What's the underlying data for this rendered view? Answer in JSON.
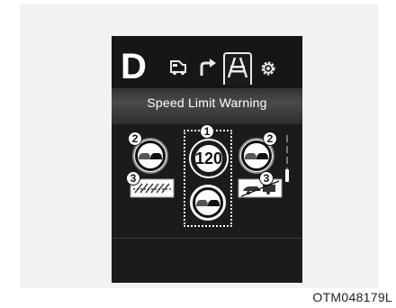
{
  "cluster": {
    "gear": "D",
    "tabs": [
      {
        "icon": "driving-assist-icon",
        "active": false
      },
      {
        "icon": "turn-by-turn-icon",
        "active": false
      },
      {
        "icon": "lane-road-icon",
        "active": true
      },
      {
        "icon": "settings-gear-icon",
        "active": false
      }
    ],
    "title": "Speed Limit Warning",
    "speed_limit": "120",
    "markers": {
      "center": "1",
      "no_passing": "2",
      "end_restriction": "3"
    }
  },
  "figure_code": "OTM048179L",
  "colors": {
    "screen": "#1b1b1b",
    "text": "#ffffff",
    "selection": "#ffffff"
  }
}
